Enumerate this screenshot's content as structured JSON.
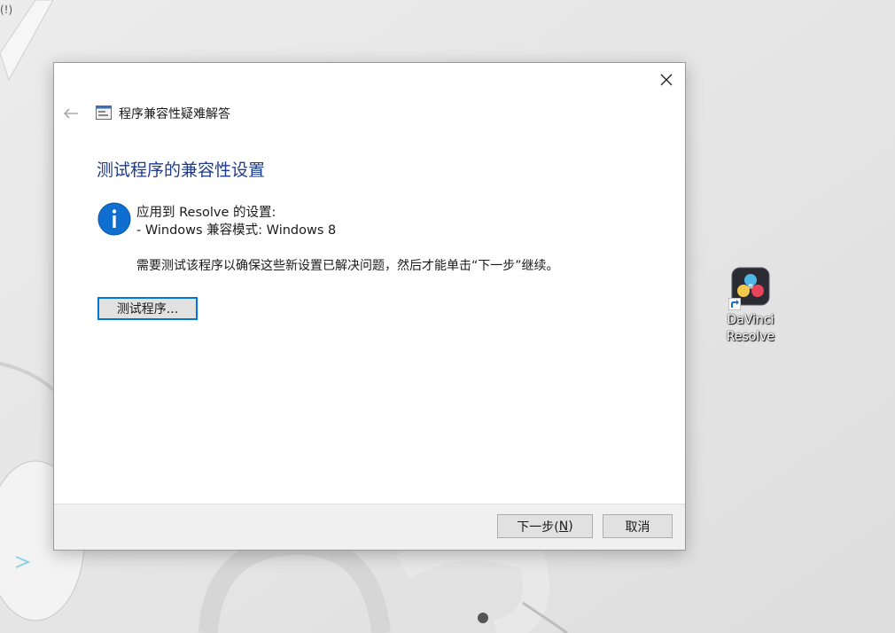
{
  "desktop": {
    "top_left_label": "(!)",
    "shortcut": {
      "label_line1": "DaVinci",
      "label_line2": "Resolve",
      "icon": "davinci-resolve-icon"
    }
  },
  "dialog": {
    "app_title": "程序兼容性疑难解答",
    "heading": "测试程序的兼容性设置",
    "applied_settings_label": "应用到 Resolve 的设置:",
    "compat_mode_line": "- Windows 兼容模式: Windows 8",
    "instruction": "需要测试该程序以确保这些新设置已解决问题，然后才能单击“下一步”继续。",
    "test_button_label": "测试程序...",
    "next_button_label": "下一步(",
    "next_button_mnemonic": "N",
    "next_button_suffix": ")",
    "cancel_button_label": "取消",
    "close_icon": "close-icon",
    "back_icon": "back-arrow-icon",
    "info_icon": "info-icon"
  },
  "colors": {
    "heading": "#1e3c8c",
    "info_icon": "#0078d7",
    "accent_border": "#0078d7",
    "footer_bg": "#f0f0f0"
  }
}
